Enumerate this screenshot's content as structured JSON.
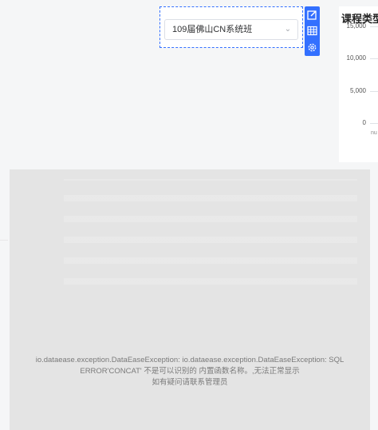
{
  "filter": {
    "selected_value": "109届佛山CN系统班",
    "dropdown_icon": "chevron-down-icon"
  },
  "toolbar": {
    "icons": [
      "edit-icon",
      "table-icon",
      "settings-icon"
    ]
  },
  "chart": {
    "title": "课程类型",
    "y_ticks": [
      "15,000",
      "10,000",
      "5,000",
      "0"
    ],
    "x_tick": "nu"
  },
  "chart_data": {
    "type": "bar",
    "title": "课程类型",
    "y_tick_labels": [
      "15,000",
      "10,000",
      "5,000",
      "0"
    ],
    "ylim": [
      0,
      15000
    ],
    "x_tick_labels": [
      "nu"
    ],
    "grid": true
  },
  "error": {
    "line1": "io.dataease.exception.DataEaseException: io.dataease.exception.DataEaseException: SQL",
    "line2": "ERROR'CONCAT' 不是可以识别的 内置函数名称。,无法正常显示",
    "line3": "如有疑问请联系管理员"
  }
}
